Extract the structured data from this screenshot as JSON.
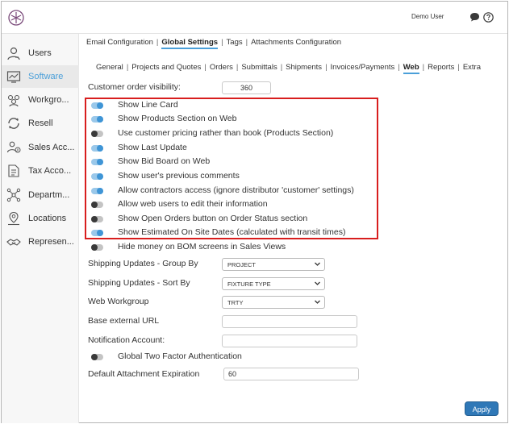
{
  "header": {
    "user_name": "Demo User"
  },
  "sidebar": {
    "items": [
      {
        "label": "Users",
        "icon": "user-icon"
      },
      {
        "label": "Software",
        "icon": "software-icon",
        "active": true
      },
      {
        "label": "Workgro...",
        "icon": "workgroup-icon"
      },
      {
        "label": "Resell",
        "icon": "resell-icon"
      },
      {
        "label": "Sales Acc...",
        "icon": "sales-account-icon"
      },
      {
        "label": "Tax Acco...",
        "icon": "tax-account-icon"
      },
      {
        "label": "Departm...",
        "icon": "department-icon"
      },
      {
        "label": "Locations",
        "icon": "location-icon"
      },
      {
        "label": "Represen...",
        "icon": "representative-icon"
      }
    ]
  },
  "tabs_primary": [
    "Email Configuration",
    "Global Settings",
    "Tags",
    "Attachments Configuration"
  ],
  "tabs_secondary": [
    "General",
    "Projects and Quotes",
    "Orders",
    "Submittals",
    "Shipments",
    "Invoices/Payments",
    "Web",
    "Reports",
    "Extra"
  ],
  "form": {
    "customer_order_visibility_label": "Customer order visibility:",
    "customer_order_visibility_value": "360",
    "toggles": [
      {
        "label": "Show Line Card",
        "on": true
      },
      {
        "label": "Show Products Section on Web",
        "on": true
      },
      {
        "label": "Use customer pricing rather than book (Products Section)",
        "on": false
      },
      {
        "label": "Show Last Update",
        "on": true
      },
      {
        "label": "Show Bid Board on Web",
        "on": true
      },
      {
        "label": "Show user's previous comments",
        "on": true
      },
      {
        "label": "Allow contractors access (ignore distributor 'customer' settings)",
        "on": true
      },
      {
        "label": "Allow web users to edit their information",
        "on": false
      },
      {
        "label": "Show Open Orders button on Order Status section",
        "on": false
      },
      {
        "label": "Show Estimated On Site Dates (calculated with transit times)",
        "on": true
      },
      {
        "label": "Hide money on BOM screens in Sales Views",
        "on": false
      }
    ],
    "shipping_group_label": "Shipping Updates - Group By",
    "shipping_group_value": "PROJECT",
    "shipping_sort_label": "Shipping Updates - Sort By",
    "shipping_sort_value": "FIXTURE TYPE",
    "web_workgroup_label": "Web Workgroup",
    "web_workgroup_value": "TRTY",
    "base_url_label": "Base external URL",
    "base_url_value": "",
    "notification_label": "Notification Account:",
    "notification_value": "",
    "two_factor_label": "Global Two Factor Authentication",
    "two_factor_on": false,
    "attachment_expiration_label": "Default Attachment Expiration",
    "attachment_expiration_value": "60"
  },
  "apply_label": "Apply",
  "colors": {
    "accent": "#4a9fd9",
    "toggle_on": "#3f95d6",
    "highlight": "#d81e1e",
    "apply_button": "#2f78b7"
  }
}
